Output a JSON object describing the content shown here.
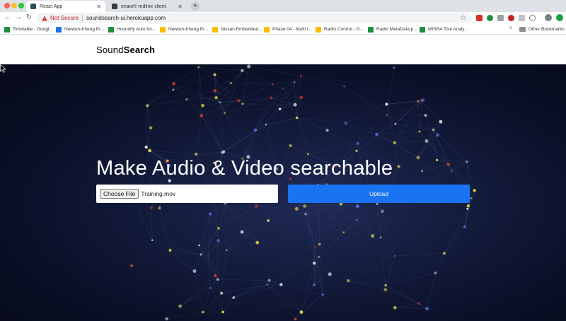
{
  "browser": {
    "tabs": [
      {
        "label": "React App"
      },
      {
        "label": "enaio® redline client"
      }
    ],
    "not_secure_label": "Not Secure",
    "url": "soundsearch-ui.herokuapp.com",
    "bookmarks": [
      {
        "label": "Timetable - Googl...",
        "icon_color": "#1e8e3e"
      },
      {
        "label": "Newton-Kheng Pr...",
        "icon_color": "#1a73e8"
      },
      {
        "label": "Houndify Auto for...",
        "icon_color": "#1e8e3e"
      },
      {
        "label": "Newton-Kheng Pr...",
        "icon_color": "#fbbc04"
      },
      {
        "label": "Nissan Embedded...",
        "icon_color": "#fbbc04"
      },
      {
        "label": "Phase 04 - Multi l...",
        "icon_color": "#fbbc04"
      },
      {
        "label": "Radio Control - G...",
        "icon_color": "#fbbc04"
      },
      {
        "label": "Radio MetaData p...",
        "icon_color": "#1e8e3e"
      },
      {
        "label": "MISRA Tool Analy...",
        "icon_color": "#1e8e3e"
      }
    ],
    "more_bookmarks": "»",
    "other_bookmarks": "Other Bookmarks"
  },
  "header": {
    "brand_regular": "Sound",
    "brand_bold": "Search"
  },
  "hero": {
    "title": "Make Audio & Video searchable",
    "choose_file_label": "Choose File",
    "file_name": "Training.mov",
    "upload_label": "Upload"
  }
}
